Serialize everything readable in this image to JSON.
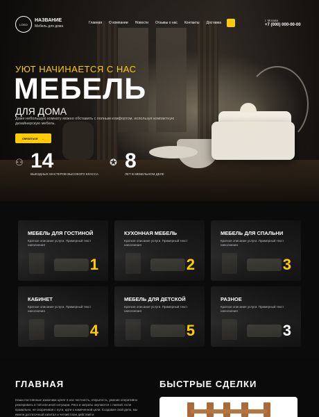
{
  "header": {
    "logo_text": "LOGO",
    "brand_name": "НАЗВАНИЕ",
    "brand_sub": "Мебель для дома",
    "nav": [
      "Главная",
      "О компании",
      "Новости",
      "Отзывы о нас",
      "Контакты",
      "Доставка"
    ],
    "city": "г. Москва",
    "phone": "+7 (000) 000-00-00"
  },
  "hero": {
    "tagline": "УЮТ НАЧИНАЕТСЯ С НАС",
    "title": "МЕБЕЛЬ",
    "subtitle": "ДЛЯ ДОМА",
    "desc": "Даже небольшую комнату можно обставить с полным комфортом, используя компактную дизайнерскую мебель.",
    "cta": "связаться",
    "stats": [
      {
        "num": "14",
        "text": "ВЫЕЗДНЫХ МАСТЕРОВ ВЫСОКОГО КЛАССА"
      },
      {
        "num": "8",
        "text": "ЛЕТ В МЕБЕЛЬНОМ ДЕЛЕ"
      }
    ]
  },
  "cards": [
    {
      "title": "МЕБЕЛЬ ДЛЯ ГОСТИНОЙ",
      "desc": "Краткое описание услуги. Примерный текст наполнения",
      "num": "1"
    },
    {
      "title": "КУХОННАЯ МЕБЕЛЬ",
      "desc": "Краткое описание услуги. Примерный текст наполнения",
      "num": "2"
    },
    {
      "title": "МЕБЕЛЬ ДЛЯ СПАЛЬНИ",
      "desc": "Краткое описание услуги. Примерный текст наполнения",
      "num": "3"
    },
    {
      "title": "КАБИНЕТ",
      "desc": "Краткое описание услуги. Примерный текст наполнения",
      "num": "4"
    },
    {
      "title": "МЕБЕЛЬ ДЛЯ ДЕТСКОЙ",
      "desc": "Краткое описание услуги. Примерный текст наполнения",
      "num": "5"
    },
    {
      "title": "РАЗНОЕ",
      "desc": "Краткое описание услуги. Примерный текст наполнения",
      "num": "3"
    }
  ],
  "main": {
    "heading": "ГЛАВНАЯ",
    "text": "Наши постоянные заказчики ценят в нас честность, открытость, умение оперативно реагировать в той или иной ситуации. Риск и затраты окупаются с лихвой, если правильно, не сворачивая с пути, идти к намеченной цели. Создавая свой дело, мы имели достаточный капитал и четкий план действий и"
  },
  "deals": {
    "heading": "БЫСТРЫЕ СДЕЛКИ"
  },
  "colors": {
    "accent": "#ffcc00",
    "background": "#0b0b0b"
  }
}
